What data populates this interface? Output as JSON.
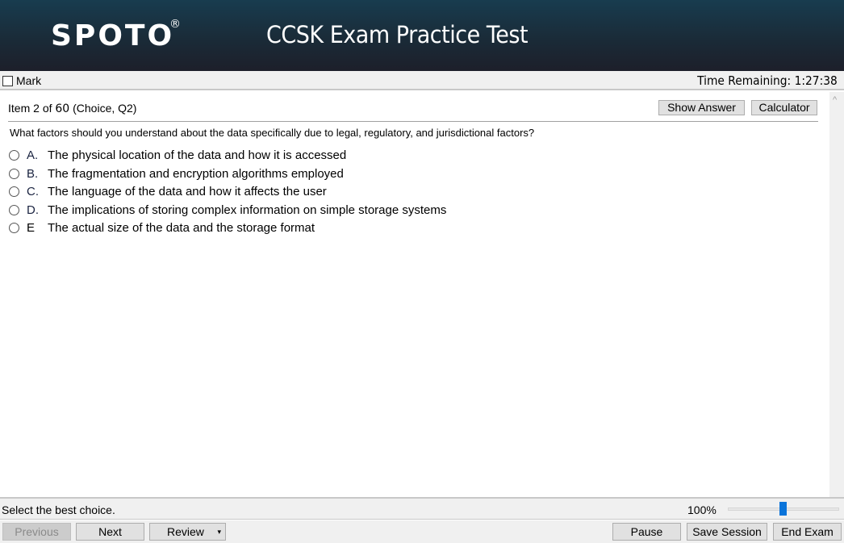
{
  "header": {
    "logo": "SPOTO",
    "logo_mark": "®",
    "title": "CCSK Exam Practice Test"
  },
  "markbar": {
    "mark_label": "Mark",
    "mark_checked": false,
    "time_remaining": "Time Remaining: 1:27:38"
  },
  "item": {
    "prefix": "Item",
    "current": "2",
    "of": "of",
    "total": "60",
    "meta": "(Choice, Q2)"
  },
  "toolbar": {
    "show_answer": "Show Answer",
    "calculator": "Calculator"
  },
  "question": {
    "text": "What factors should you understand about the data specifically due to legal, regulatory, and jurisdictional factors?",
    "options": [
      {
        "letter": "A.",
        "text": "The physical location of the data and how it is accessed",
        "selected": false
      },
      {
        "letter": "B.",
        "text": "The fragmentation and encryption algorithms employed",
        "selected": false
      },
      {
        "letter": "C.",
        "text": "The language of the data and how it affects the user",
        "selected": false
      },
      {
        "letter": "D.",
        "text": "The implications of storing complex information on simple storage systems",
        "selected": false
      },
      {
        "letter": "E",
        "text": "The actual size of the data and the storage format",
        "selected": false
      }
    ]
  },
  "status": {
    "instruction": "Select the best choice.",
    "zoom_label": "100%",
    "zoom_value_percent": 100
  },
  "nav": {
    "previous": "Previous",
    "next": "Next",
    "review": "Review",
    "review_caret": "▾",
    "pause": "Pause",
    "save_session": "Save Session",
    "end_exam": "End Exam"
  },
  "icons": {
    "scroll_up": "^",
    "dropdown": "chevron-down-icon"
  },
  "colors": {
    "header_top": "#183c4f",
    "header_bottom": "#1d1f2a",
    "slider_thumb": "#0a74da",
    "option_letter": "#1a2340"
  }
}
